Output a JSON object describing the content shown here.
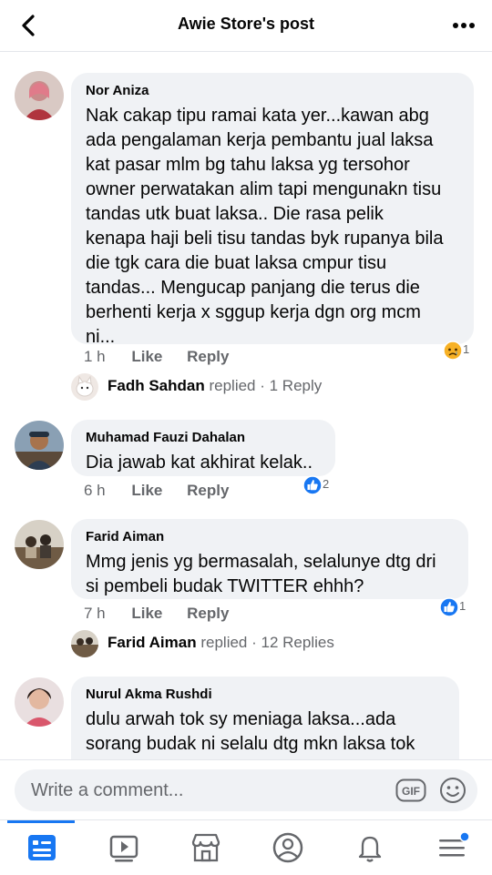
{
  "header": {
    "title": "Awie Store's post"
  },
  "comments": [
    {
      "author": "Nor Aniza",
      "text": "Nak cakap tipu ramai kata yer...kawan abg\nada pengalaman kerja pembantu jual laksa\nkat pasar mlm bg tahu laksa yg tersohor\nowner perwatakan alim tapi mengunakn tisu\ntandas utk buat laksa.. Die rasa pelik\nkenapa haji beli tisu tandas byk rupanya bila\ndie tgk cara die buat laksa cmpur tisu\ntandas... Mengucap panjang die terus die\nberhenti kerja x sggup kerja dgn org mcm\nni...",
      "time": "1 h",
      "like": "Like",
      "reply": "Reply",
      "reaction_count": "1",
      "reaction_icon": "sad-face-icon",
      "replied": {
        "name": "Fadh Sahdan",
        "action": "replied",
        "count_text": "· 1 Reply"
      }
    },
    {
      "author": "Muhamad Fauzi Dahalan",
      "text": "Dia jawab kat akhirat kelak..",
      "time": "6 h",
      "like": "Like",
      "reply": "Reply",
      "reaction_count": "2",
      "reaction_icon": "thumbs-up-icon"
    },
    {
      "author": "Farid Aiman",
      "text": "Mmg jenis yg bermasalah, selalunye dtg dri\nsi pembeli budak TWITTER ehhh?",
      "time": "7 h",
      "like": "Like",
      "reply": "Reply",
      "reaction_count": "1",
      "reaction_icon": "thumbs-up-icon",
      "replied": {
        "name": "Farid Aiman",
        "action": "replied",
        "count_text": "· 12 Replies"
      }
    },
    {
      "author": "Nurul Akma Rushdi",
      "text": "dulu arwah tok sy meniaga laksa...ada\nsorang budak ni selalu dtg mkn laksa tok"
    }
  ],
  "composer": {
    "placeholder": "Write a comment...",
    "gif_label": "GIF"
  },
  "tabs": [
    "feed-icon",
    "watch-icon",
    "marketplace-icon",
    "profile-icon",
    "notifications-icon",
    "menu-icon"
  ],
  "colors": {
    "accent": "#1877f2",
    "bubble": "#f0f2f5",
    "secondary_text": "#65676b"
  }
}
